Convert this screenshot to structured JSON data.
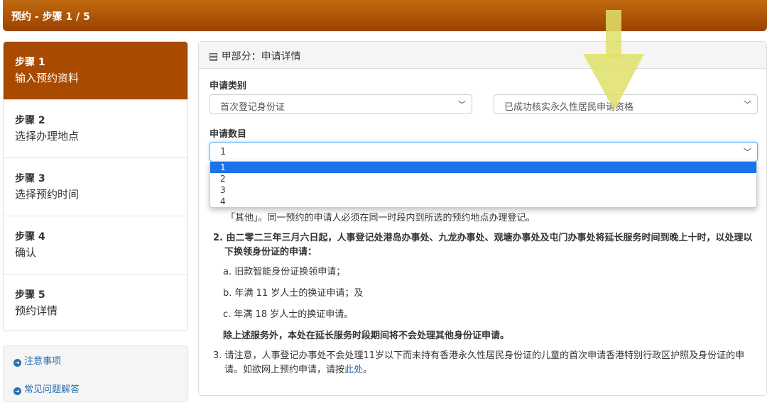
{
  "header": {
    "title": "预约 - 步骤 1 / 5"
  },
  "steps": [
    {
      "step": "步骤 1",
      "label": "输入预约资料"
    },
    {
      "step": "步骤 2",
      "label": "选择办理地点"
    },
    {
      "step": "步骤 3",
      "label": "选择预约时间"
    },
    {
      "step": "步骤 4",
      "label": "确认"
    },
    {
      "step": "步骤 5",
      "label": "预约详情"
    }
  ],
  "links": [
    {
      "label": "注意事项"
    },
    {
      "label": "常见问题解答"
    }
  ],
  "panel": {
    "title": "甲部分：申请详情",
    "category_label": "申请类别",
    "category_value": "首次登记身份证",
    "category_sub_value": "已成功核实永久性居民申请资格",
    "count_label": "申请数目",
    "count_value": "1",
    "count_options": [
      "1",
      "2",
      "3",
      "4"
    ]
  },
  "notes": {
    "n1_tail": "「其他」。同一预约的申请人必须在同一时段内到所选的预约地点办理登记。",
    "n2": "2. 由二零二三年三月六日起，人事登记处港岛办事处、九龙办事处、观塘办事处及屯门办事处将延长服务时间到晚上十时，以处理以下换领身份证的申请：",
    "n2a": "a. 旧款智能身份证换领申请；",
    "n2b": "b. 年满 11 岁人士的换证申请；及",
    "n2c": "c. 年满 18 岁人士的换证申请。",
    "n2_foot": "除上述服务外，本处在延长服务时段期间将不会处理其他身份证申请。",
    "n3": "3. 请注意，人事登记办事处不会处理11岁以下而未持有香港永久性居民身份证的儿童的首次申请香港特别行政区护照及身份证的申请。如欲网上预约申请，请按",
    "n3_link": "此处",
    "n3_end": "。"
  }
}
